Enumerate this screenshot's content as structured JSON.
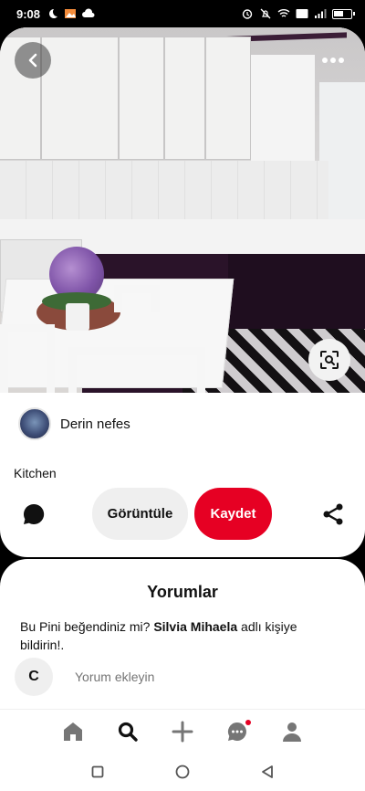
{
  "status_bar": {
    "time": "9:08"
  },
  "pin": {
    "author_name": "Derin nefes",
    "title": "Kitchen",
    "view_label": "Görüntüle",
    "save_label": "Kaydet"
  },
  "comments": {
    "title": "Yorumlar",
    "prompt_before": "Bu Pini beğendiniz mi? ",
    "prompt_user": "Silvia Mihaela",
    "prompt_after": " adlı kişiye bildirin!.",
    "user_initial": "C",
    "input_placeholder": "Yorum ekleyin"
  },
  "colors": {
    "accent": "#e60023",
    "button_gray": "#efefef"
  },
  "icons": [
    "back-icon",
    "more-icon",
    "visual-search-icon",
    "comment-icon",
    "share-icon",
    "home-icon",
    "search-icon",
    "add-icon",
    "messages-icon",
    "profile-icon"
  ]
}
